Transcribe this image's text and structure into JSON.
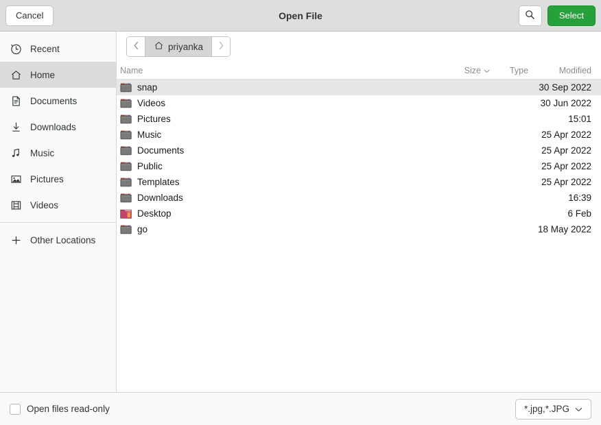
{
  "header": {
    "title": "Open File",
    "cancel_label": "Cancel",
    "select_label": "Select",
    "search_icon": "search-icon"
  },
  "sidebar": {
    "items": [
      {
        "label": "Recent",
        "icon": "clock-icon",
        "selected": false
      },
      {
        "label": "Home",
        "icon": "home-icon",
        "selected": true
      },
      {
        "label": "Documents",
        "icon": "document-icon",
        "selected": false
      },
      {
        "label": "Downloads",
        "icon": "download-icon",
        "selected": false
      },
      {
        "label": "Music",
        "icon": "music-note-icon",
        "selected": false
      },
      {
        "label": "Pictures",
        "icon": "image-icon",
        "selected": false
      },
      {
        "label": "Videos",
        "icon": "film-icon",
        "selected": false
      }
    ],
    "other_locations": {
      "label": "Other Locations",
      "icon": "plus-icon"
    }
  },
  "pathbar": {
    "back_icon": "chevron-left-icon",
    "forward_icon": "chevron-right-icon",
    "crumb_label": "priyanka",
    "crumb_icon": "home-icon"
  },
  "columns": {
    "name": "Name",
    "size": "Size",
    "type": "Type",
    "modified": "Modified",
    "sort_icon": "chevron-down-icon"
  },
  "files": [
    {
      "name": "snap",
      "size": "",
      "type": "",
      "modified": "30 Sep 2022",
      "icon": "folder-icon",
      "selected": true
    },
    {
      "name": "Videos",
      "size": "",
      "type": "",
      "modified": "30 Jun 2022",
      "icon": "folder-icon",
      "selected": false
    },
    {
      "name": "Pictures",
      "size": "",
      "type": "",
      "modified": "15:01",
      "icon": "folder-icon",
      "selected": false
    },
    {
      "name": "Music",
      "size": "",
      "type": "",
      "modified": "25 Apr 2022",
      "icon": "folder-icon",
      "selected": false
    },
    {
      "name": "Documents",
      "size": "",
      "type": "",
      "modified": "25 Apr 2022",
      "icon": "folder-icon",
      "selected": false
    },
    {
      "name": "Public",
      "size": "",
      "type": "",
      "modified": "25 Apr 2022",
      "icon": "folder-icon",
      "selected": false
    },
    {
      "name": "Templates",
      "size": "",
      "type": "",
      "modified": "25 Apr 2022",
      "icon": "folder-icon",
      "selected": false
    },
    {
      "name": "Downloads",
      "size": "",
      "type": "",
      "modified": "16:39",
      "icon": "folder-icon",
      "selected": false
    },
    {
      "name": "Desktop",
      "size": "",
      "type": "",
      "modified": "6 Feb",
      "icon": "folder-desktop-icon",
      "selected": false
    },
    {
      "name": "go",
      "size": "",
      "type": "",
      "modified": "18 May 2022",
      "icon": "folder-icon",
      "selected": false
    }
  ],
  "footer": {
    "readonly_label": "Open files read-only",
    "readonly_checked": false,
    "filter_value": "*.jpg,*.JPG",
    "filter_icon": "chevron-down-icon"
  },
  "colors": {
    "headerbar_bg": "#dedede",
    "select_green": "#26a13a",
    "row_selected": "#e6e6e6",
    "sidebar_selected": "#dcdcdc",
    "folder_grey": "#7a7a78",
    "folder_tab_red": "#a33b3b",
    "folder_desktop": "#c4436b"
  }
}
